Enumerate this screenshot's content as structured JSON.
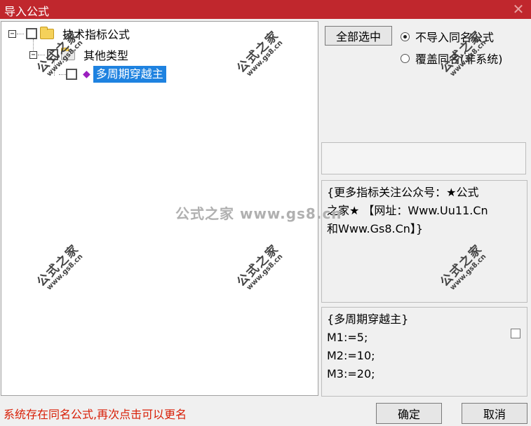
{
  "window": {
    "title": "导入公式",
    "close_glyph": "✕"
  },
  "tree": {
    "root": {
      "expander": "−",
      "label": "技术指标公式"
    },
    "child": {
      "expander": "−",
      "label": "其他类型"
    },
    "leaf": {
      "label": "多周期穿越主"
    }
  },
  "options": {
    "select_all_label": "全部选中",
    "radio_no_import": "不导入同名公式",
    "radio_overwrite": "覆盖同名(非系统)",
    "selected_radio": "no_import"
  },
  "info": {
    "line1": "{更多指标关注公众号：★公式",
    "line2": "之家★ 【网址：Www.Uu11.Cn",
    "line3": "和Www.Gs8.Cn】}"
  },
  "code": {
    "line1": "{多周期穿越主}",
    "line2": "M1:=5;",
    "line3": "M2:=10;",
    "line4": "M3:=20;"
  },
  "status": "系统存在同名公式,再次点击可以更名",
  "buttons": {
    "ok": "确定",
    "cancel": "取消"
  },
  "watermark": {
    "center": "公式之家 www.gs8.cn",
    "stamp_text": "公式之家",
    "stamp_url": "www.gs8.cn"
  }
}
